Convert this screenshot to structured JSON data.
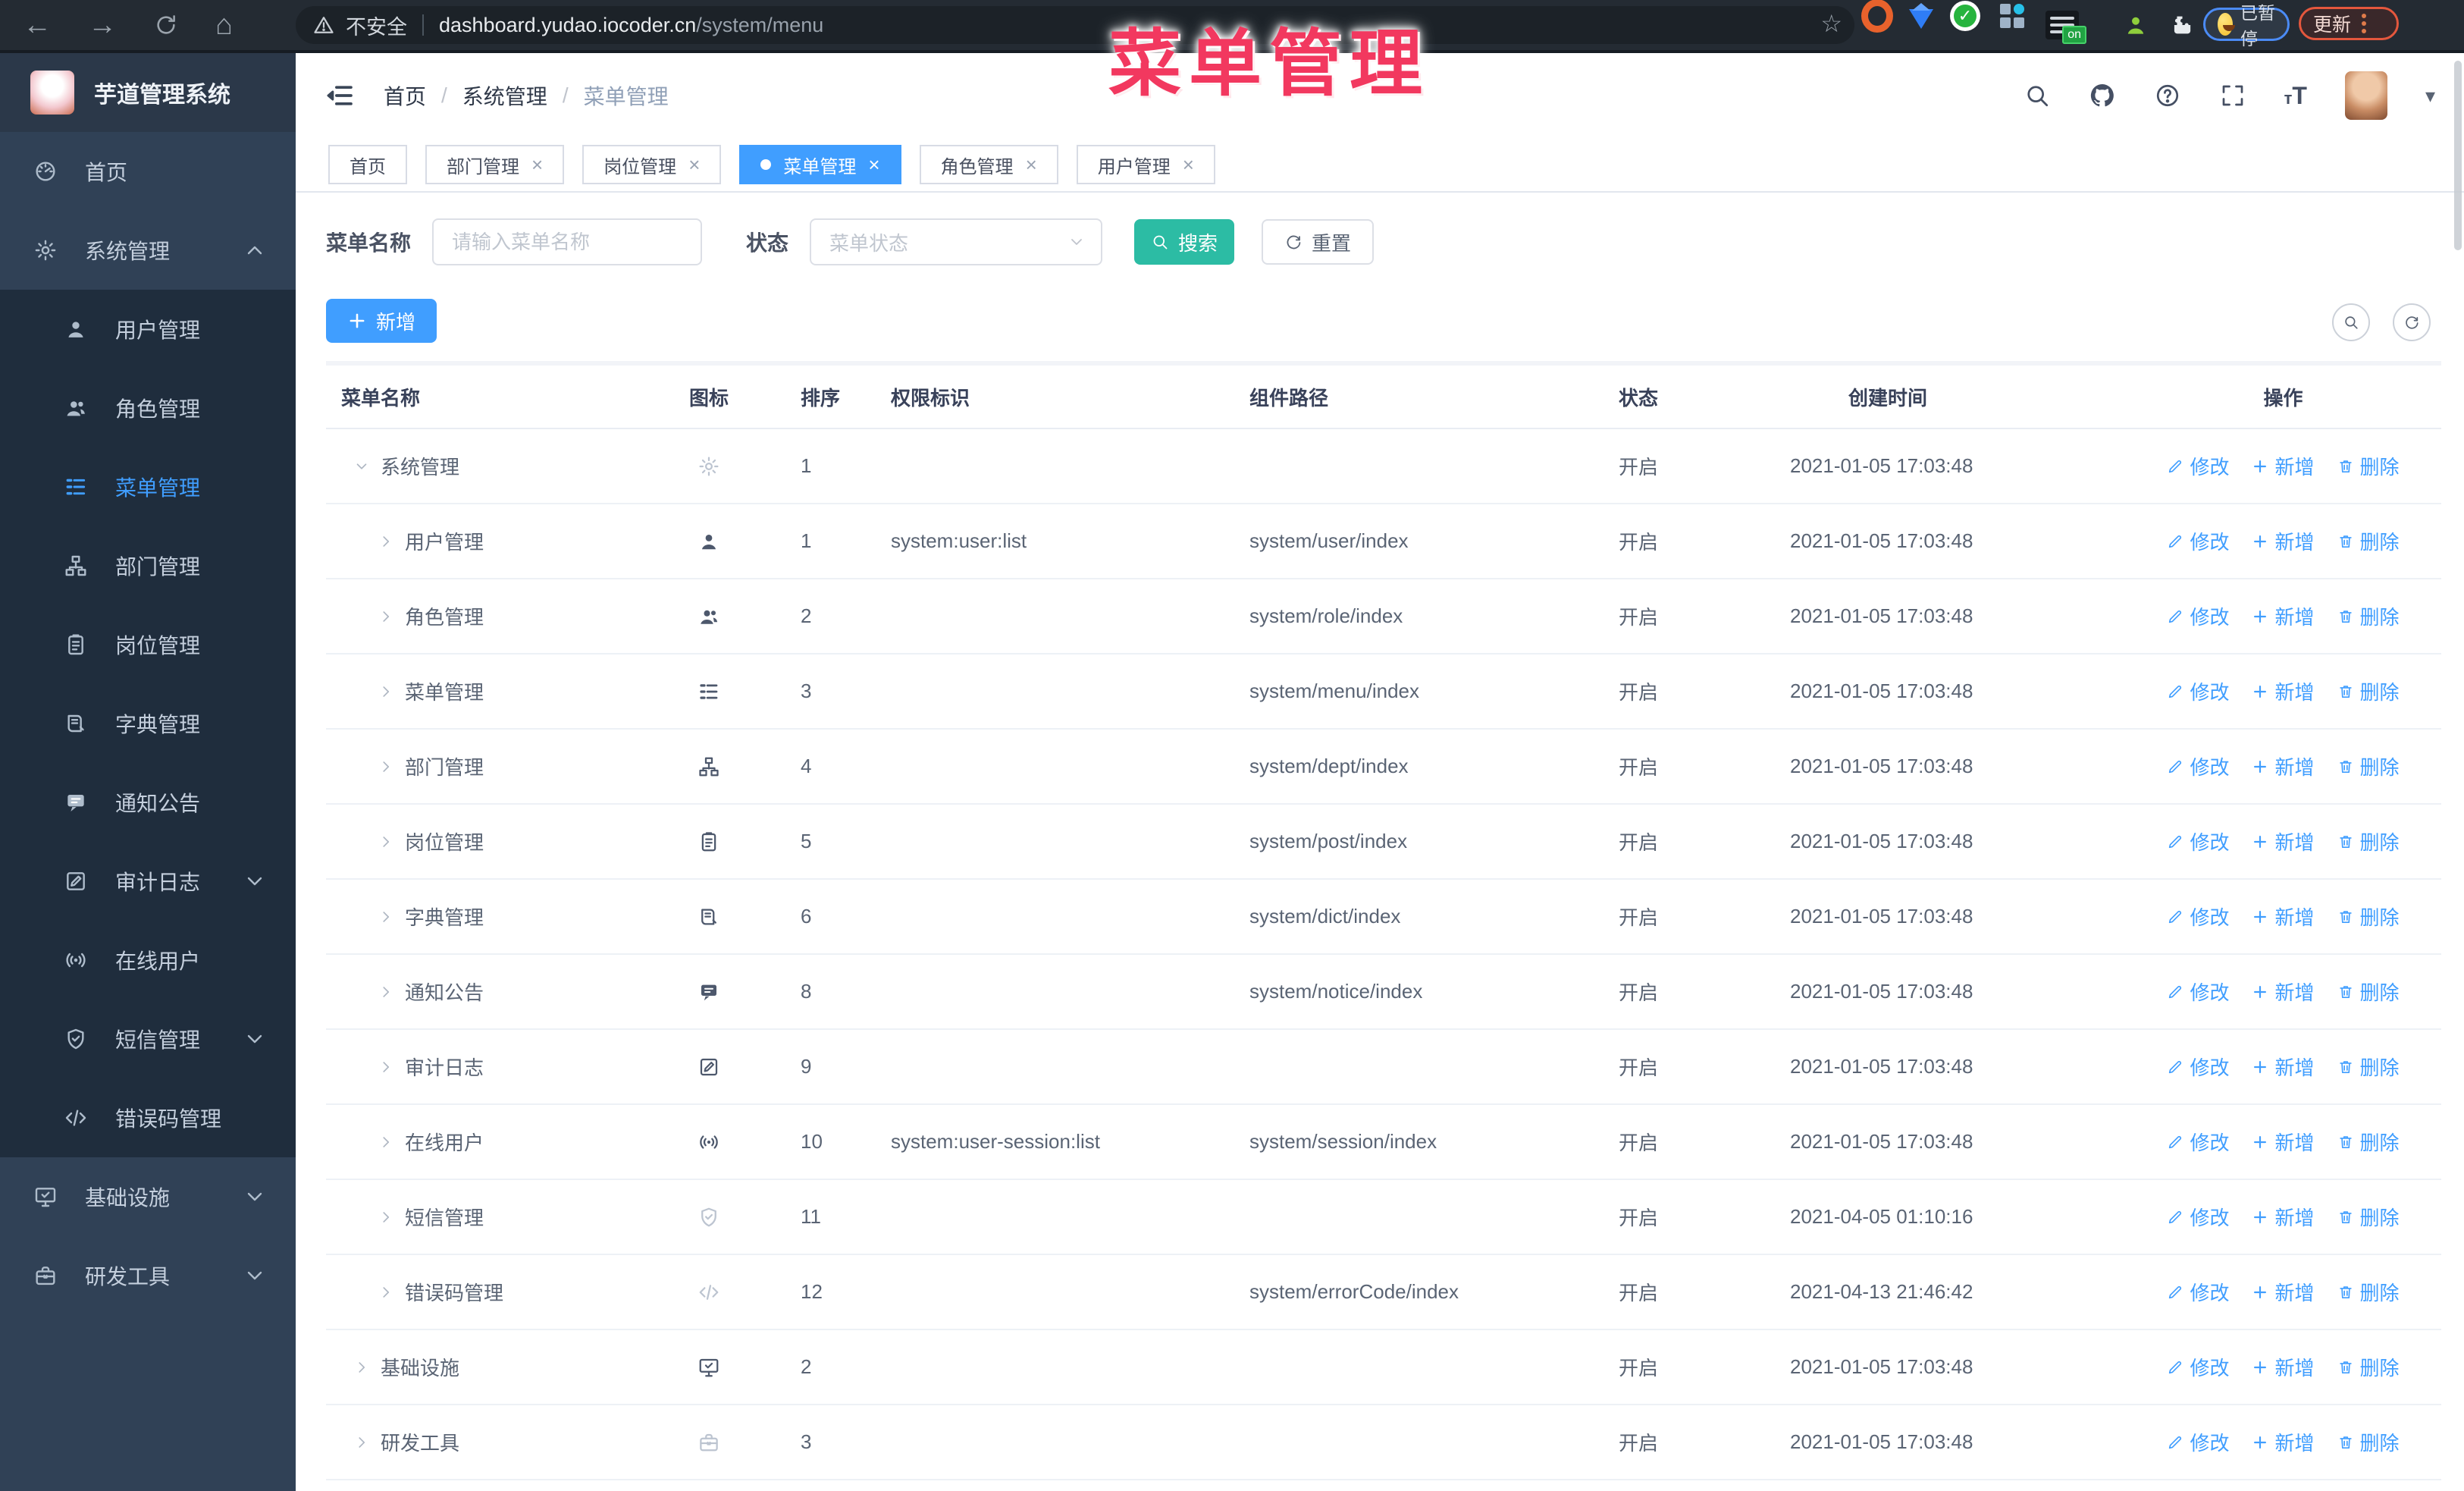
{
  "colors": {
    "primary": "#409eff",
    "success_button": "#2cbca4",
    "sidebar_bg": "#304156",
    "submenu_bg": "#1f2d3d",
    "overlay_pink": "#f2385f",
    "chrome_bg": "#242b33",
    "link_blue": "#409eff"
  },
  "overlay_title": "菜单管理",
  "browser": {
    "security_label": "不安全",
    "url_host": "dashboard.yudao.iocoder.cn",
    "url_path": "/system/menu",
    "paused_badge": "已暂停",
    "update_button": "更新",
    "ext_on_badge": "on"
  },
  "sidebar": {
    "app_title": "芋道管理系统",
    "items": [
      {
        "label": "首页",
        "icon": "dashboard-icon"
      },
      {
        "label": "系统管理",
        "icon": "gear-icon",
        "chevron": "up",
        "open": true,
        "children": [
          {
            "label": "用户管理",
            "icon": "user-icon"
          },
          {
            "label": "角色管理",
            "icon": "users-icon"
          },
          {
            "label": "菜单管理",
            "icon": "menu-icon",
            "active": true
          },
          {
            "label": "部门管理",
            "icon": "tree-icon"
          },
          {
            "label": "岗位管理",
            "icon": "badge-icon"
          },
          {
            "label": "字典管理",
            "icon": "book-icon"
          },
          {
            "label": "通知公告",
            "icon": "chat-icon"
          },
          {
            "label": "审计日志",
            "icon": "log-icon",
            "chevron": "down"
          },
          {
            "label": "在线用户",
            "icon": "online-icon"
          },
          {
            "label": "短信管理",
            "icon": "shield-icon",
            "chevron": "down"
          },
          {
            "label": "错误码管理",
            "icon": "code-icon"
          }
        ]
      },
      {
        "label": "基础设施",
        "icon": "monitor-icon",
        "chevron": "down"
      },
      {
        "label": "研发工具",
        "icon": "briefcase-icon",
        "chevron": "down"
      }
    ]
  },
  "header": {
    "breadcrumb": [
      "首页",
      "系统管理",
      "菜单管理"
    ]
  },
  "tabs": [
    {
      "label": "首页",
      "closable": false
    },
    {
      "label": "部门管理",
      "closable": true
    },
    {
      "label": "岗位管理",
      "closable": true
    },
    {
      "label": "菜单管理",
      "closable": true,
      "active": true
    },
    {
      "label": "角色管理",
      "closable": true
    },
    {
      "label": "用户管理",
      "closable": true
    }
  ],
  "filters": {
    "name_label": "菜单名称",
    "name_placeholder": "请输入菜单名称",
    "status_label": "状态",
    "status_placeholder": "菜单状态",
    "search_label": "搜索",
    "reset_label": "重置"
  },
  "toolbar": {
    "add_label": "新增"
  },
  "table": {
    "columns": [
      "菜单名称",
      "图标",
      "排序",
      "权限标识",
      "组件路径",
      "状态",
      "创建时间",
      "操作"
    ],
    "ops": [
      "修改",
      "新增",
      "删除"
    ],
    "rows": [
      {
        "name": "系统管理",
        "icon": "gear-icon",
        "light": true,
        "level": 0,
        "expanded": true,
        "sort": "1",
        "perm": "",
        "path": "",
        "status": "开启",
        "time": "2021-01-05 17:03:48"
      },
      {
        "name": "用户管理",
        "icon": "user-icon",
        "level": 1,
        "sort": "1",
        "perm": "system:user:list",
        "path": "system/user/index",
        "status": "开启",
        "time": "2021-01-05 17:03:48"
      },
      {
        "name": "角色管理",
        "icon": "users-icon",
        "level": 1,
        "sort": "2",
        "perm": "",
        "path": "system/role/index",
        "status": "开启",
        "time": "2021-01-05 17:03:48"
      },
      {
        "name": "菜单管理",
        "icon": "menu-icon",
        "level": 1,
        "sort": "3",
        "perm": "",
        "path": "system/menu/index",
        "status": "开启",
        "time": "2021-01-05 17:03:48"
      },
      {
        "name": "部门管理",
        "icon": "tree-icon",
        "level": 1,
        "sort": "4",
        "perm": "",
        "path": "system/dept/index",
        "status": "开启",
        "time": "2021-01-05 17:03:48"
      },
      {
        "name": "岗位管理",
        "icon": "badge-icon",
        "level": 1,
        "sort": "5",
        "perm": "",
        "path": "system/post/index",
        "status": "开启",
        "time": "2021-01-05 17:03:48"
      },
      {
        "name": "字典管理",
        "icon": "book-icon",
        "level": 1,
        "sort": "6",
        "perm": "",
        "path": "system/dict/index",
        "status": "开启",
        "time": "2021-01-05 17:03:48"
      },
      {
        "name": "通知公告",
        "icon": "chat-icon",
        "level": 1,
        "sort": "8",
        "perm": "",
        "path": "system/notice/index",
        "status": "开启",
        "time": "2021-01-05 17:03:48"
      },
      {
        "name": "审计日志",
        "icon": "log-icon",
        "level": 1,
        "sort": "9",
        "perm": "",
        "path": "",
        "status": "开启",
        "time": "2021-01-05 17:03:48"
      },
      {
        "name": "在线用户",
        "icon": "online-icon",
        "level": 1,
        "sort": "10",
        "perm": "system:user-session:list",
        "path": "system/session/index",
        "status": "开启",
        "time": "2021-01-05 17:03:48"
      },
      {
        "name": "短信管理",
        "icon": "shield-icon",
        "light": true,
        "level": 1,
        "sort": "11",
        "perm": "",
        "path": "",
        "status": "开启",
        "time": "2021-04-05 01:10:16"
      },
      {
        "name": "错误码管理",
        "icon": "code-icon",
        "light": true,
        "level": 1,
        "sort": "12",
        "perm": "",
        "path": "system/errorCode/index",
        "status": "开启",
        "time": "2021-04-13 21:46:42"
      },
      {
        "name": "基础设施",
        "icon": "monitor-icon",
        "level": 0,
        "sort": "2",
        "perm": "",
        "path": "",
        "status": "开启",
        "time": "2021-01-05 17:03:48"
      },
      {
        "name": "研发工具",
        "icon": "briefcase-icon",
        "light": true,
        "level": 0,
        "sort": "3",
        "perm": "",
        "path": "",
        "status": "开启",
        "time": "2021-01-05 17:03:48"
      }
    ]
  }
}
